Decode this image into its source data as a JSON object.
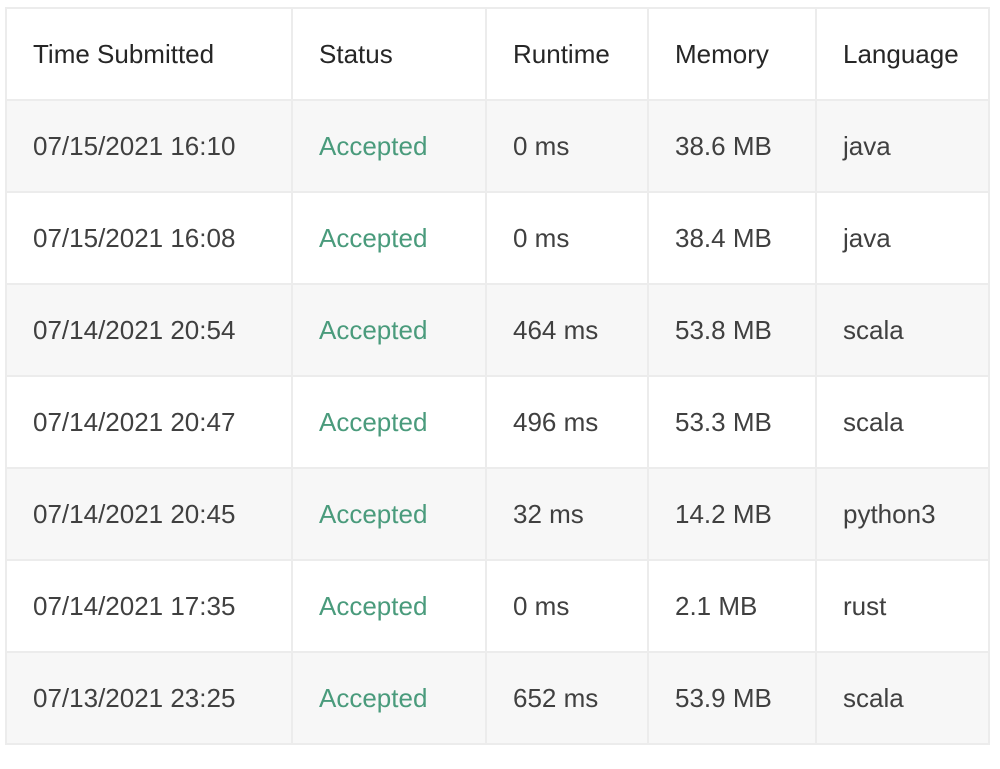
{
  "columns": [
    "Time Submitted",
    "Status",
    "Runtime",
    "Memory",
    "Language"
  ],
  "colors": {
    "accepted": "#4a9b7c",
    "row_shade": "#f7f7f7",
    "border": "#ececec"
  },
  "rows": [
    {
      "time": "07/15/2021 16:10",
      "status": "Accepted",
      "runtime": "0 ms",
      "memory": "38.6 MB",
      "language": "java"
    },
    {
      "time": "07/15/2021 16:08",
      "status": "Accepted",
      "runtime": "0 ms",
      "memory": "38.4 MB",
      "language": "java"
    },
    {
      "time": "07/14/2021 20:54",
      "status": "Accepted",
      "runtime": "464 ms",
      "memory": "53.8 MB",
      "language": "scala"
    },
    {
      "time": "07/14/2021 20:47",
      "status": "Accepted",
      "runtime": "496 ms",
      "memory": "53.3 MB",
      "language": "scala"
    },
    {
      "time": "07/14/2021 20:45",
      "status": "Accepted",
      "runtime": "32 ms",
      "memory": "14.2 MB",
      "language": "python3"
    },
    {
      "time": "07/14/2021 17:35",
      "status": "Accepted",
      "runtime": "0 ms",
      "memory": "2.1 MB",
      "language": "rust"
    },
    {
      "time": "07/13/2021 23:25",
      "status": "Accepted",
      "runtime": "652 ms",
      "memory": "53.9 MB",
      "language": "scala"
    }
  ]
}
